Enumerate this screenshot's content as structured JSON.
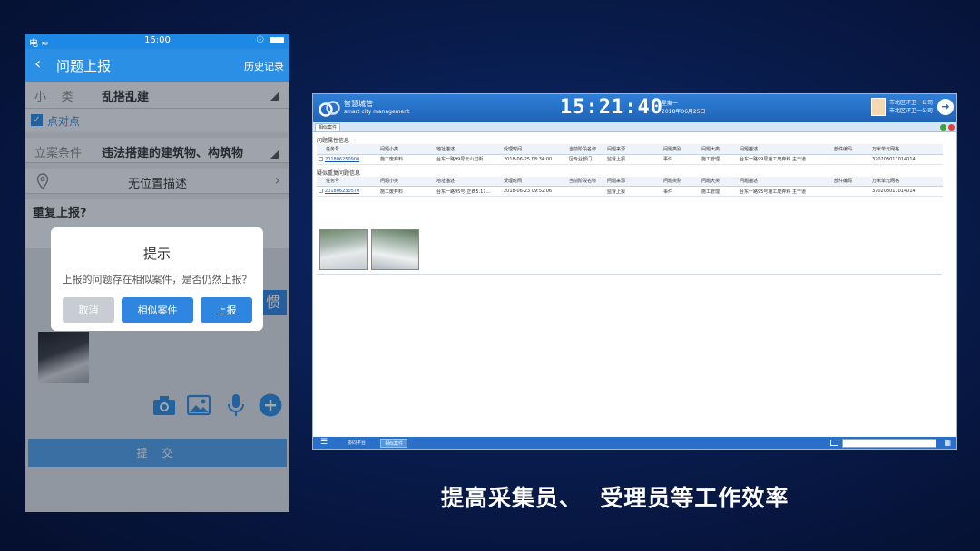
{
  "phone": {
    "status": {
      "left": "电 ≈",
      "time": "15:00",
      "right": "☉"
    },
    "nav": {
      "back_icon": "‹",
      "title": "问题上报",
      "history": "历史记录"
    },
    "category": {
      "label": "小    类",
      "value": "乱搭乱建"
    },
    "locate_label": "点对点",
    "condition": {
      "label": "立案条件",
      "value": "违法搭建的建筑物、构筑物"
    },
    "location": {
      "value": "无位置描述"
    },
    "repeat_label": "重复上报?",
    "side_button": "惯",
    "dialog": {
      "title": "提示",
      "message": "上报的问题存在相似案件，是否仍然上报？",
      "cancel": "取消",
      "similar": "相似案件",
      "report": "上报"
    },
    "submit": "提 交",
    "colors": {
      "primary": "#2b8fe6",
      "button": "#2f86e0",
      "disabled": "#c8cdd3"
    }
  },
  "desktop": {
    "brand": {
      "name": "智慧城管",
      "subtitle": "smart city management"
    },
    "clock": "15:21:40",
    "date": {
      "weekday": "星期一",
      "date": "2018年06月25日"
    },
    "user": {
      "line1": "市北区环卫一公司",
      "line2": "市北区环卫一公司"
    },
    "tab": "相似案件",
    "section1": "问题属性信息",
    "section2": "疑似重复问题信息",
    "columns": [
      "任务号",
      "问题小类",
      "地址描述",
      "受理时间",
      "当前阶段名称",
      "问题来源",
      "问题类别",
      "问题大类",
      "问题描述",
      "部件编码",
      "万米单元网格"
    ],
    "row1": [
      "201806250900",
      "施工废弃料",
      "台东一路99号云山过街...",
      "2018-06-25 08:34:00",
      "区专业部门...",
      "监督上报",
      "事件",
      "施工管理",
      "台东一路99号施工废弃料 主干道",
      "",
      "370203011014014"
    ],
    "row2": [
      "201806230570",
      "施工废弃料",
      "台东一路95号(正西5.17...",
      "2018-06-23 09:52:06",
      "",
      "监督上报",
      "事件",
      "施工管理",
      "台东一路95号施工废弃料 主干道",
      "",
      "370203011014014"
    ],
    "footer": {
      "tab1": "协同平台",
      "tab2": "相似案件"
    }
  },
  "caption": "提高采集员、  受理员等工作效率"
}
